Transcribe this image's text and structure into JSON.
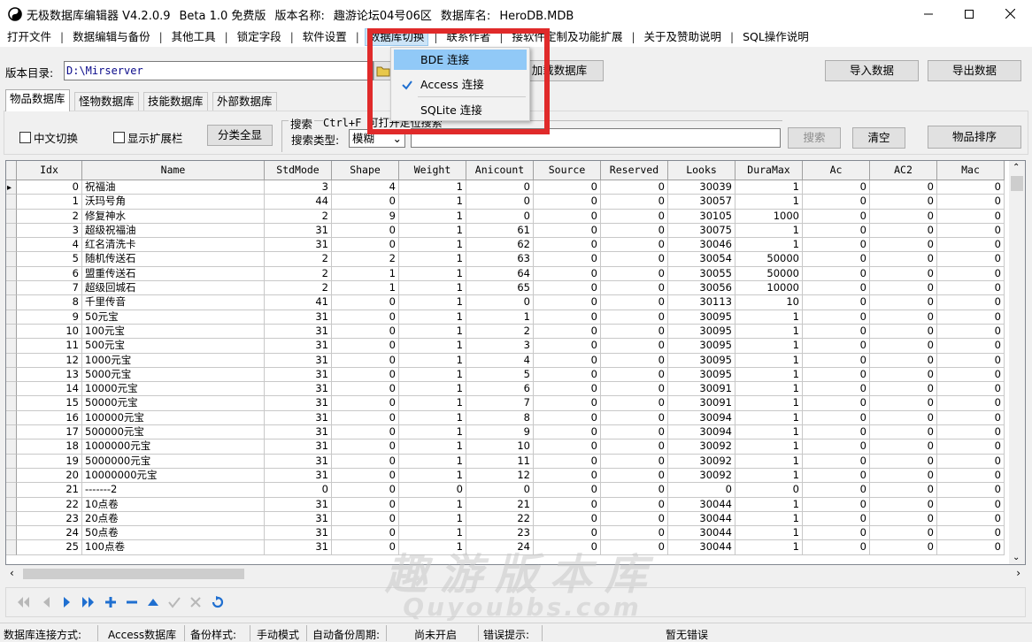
{
  "window": {
    "title_parts": [
      "无极数据库编辑器 V4.2.0.9",
      "Beta 1.0 免费版",
      "版本名称:",
      "趣游论坛04号06区",
      "数据库名:",
      "HeroDB.MDB"
    ],
    "controls": {
      "minimize": "—",
      "maximize": "☐",
      "close": "✕"
    }
  },
  "menu": {
    "items": [
      "打开文件",
      "数据编辑与备份",
      "其他工具",
      "锁定字段",
      "软件设置",
      "数据库切换",
      "联系作者",
      "接软件定制及功能扩展",
      "关于及赞助说明",
      "SQL操作说明"
    ],
    "separator": "|"
  },
  "dropdown": {
    "items": [
      {
        "label": "BDE 连接",
        "checked": false,
        "highlighted": true
      },
      {
        "label": "Access 连接",
        "checked": true,
        "highlighted": false
      },
      {
        "label": "SQLite 连接",
        "checked": false,
        "highlighted": false
      }
    ]
  },
  "toolbar": {
    "dir_label": "版本目录:",
    "dir_value": "D:\\Mirserver",
    "load_db_label": "加载数据库",
    "import_label": "导入数据",
    "export_label": "导出数据"
  },
  "tabs": [
    "物品数据库",
    "怪物数据库",
    "技能数据库",
    "外部数据库"
  ],
  "filters": {
    "chinese_toggle": "中文切换",
    "show_extended": "显示扩展栏",
    "show_all_categories": "分类全显",
    "search_group_title": "搜索",
    "search_hint": "Ctrl+F 可打开定位搜索",
    "search_type_label": "搜索类型:",
    "search_type_value": "模糊",
    "search_button": "搜索",
    "clear_button": "清空",
    "sort_button": "物品排序"
  },
  "grid": {
    "columns": [
      "Idx",
      "Name",
      "StdMode",
      "Shape",
      "Weight",
      "Anicount",
      "Source",
      "Reserved",
      "Looks",
      "DuraMax",
      "Ac",
      "AC2",
      "Mac"
    ],
    "rows": [
      [
        "0",
        "祝福油",
        "3",
        "4",
        "1",
        "0",
        "0",
        "0",
        "30039",
        "1",
        "0",
        "0",
        "0"
      ],
      [
        "1",
        "沃玛号角",
        "44",
        "0",
        "1",
        "0",
        "0",
        "0",
        "30057",
        "1",
        "0",
        "0",
        "0"
      ],
      [
        "2",
        "修复神水",
        "2",
        "9",
        "1",
        "0",
        "0",
        "0",
        "30105",
        "1000",
        "0",
        "0",
        "0"
      ],
      [
        "3",
        "超级祝福油",
        "31",
        "0",
        "1",
        "61",
        "0",
        "0",
        "30075",
        "1",
        "0",
        "0",
        "0"
      ],
      [
        "4",
        "红名清洗卡",
        "31",
        "0",
        "1",
        "62",
        "0",
        "0",
        "30046",
        "1",
        "0",
        "0",
        "0"
      ],
      [
        "5",
        "随机传送石",
        "2",
        "2",
        "1",
        "63",
        "0",
        "0",
        "30054",
        "50000",
        "0",
        "0",
        "0"
      ],
      [
        "6",
        "盟重传送石",
        "2",
        "1",
        "1",
        "64",
        "0",
        "0",
        "30055",
        "50000",
        "0",
        "0",
        "0"
      ],
      [
        "7",
        "超级回城石",
        "2",
        "1",
        "1",
        "65",
        "0",
        "0",
        "30056",
        "10000",
        "0",
        "0",
        "0"
      ],
      [
        "8",
        "千里传音",
        "41",
        "0",
        "1",
        "0",
        "0",
        "0",
        "30113",
        "10",
        "0",
        "0",
        "0"
      ],
      [
        "9",
        "50元宝",
        "31",
        "0",
        "1",
        "1",
        "0",
        "0",
        "30095",
        "1",
        "0",
        "0",
        "0"
      ],
      [
        "10",
        "100元宝",
        "31",
        "0",
        "1",
        "2",
        "0",
        "0",
        "30095",
        "1",
        "0",
        "0",
        "0"
      ],
      [
        "11",
        "500元宝",
        "31",
        "0",
        "1",
        "3",
        "0",
        "0",
        "30095",
        "1",
        "0",
        "0",
        "0"
      ],
      [
        "12",
        "1000元宝",
        "31",
        "0",
        "1",
        "4",
        "0",
        "0",
        "30095",
        "1",
        "0",
        "0",
        "0"
      ],
      [
        "13",
        "5000元宝",
        "31",
        "0",
        "1",
        "5",
        "0",
        "0",
        "30095",
        "1",
        "0",
        "0",
        "0"
      ],
      [
        "14",
        "10000元宝",
        "31",
        "0",
        "1",
        "6",
        "0",
        "0",
        "30091",
        "1",
        "0",
        "0",
        "0"
      ],
      [
        "15",
        "50000元宝",
        "31",
        "0",
        "1",
        "7",
        "0",
        "0",
        "30091",
        "1",
        "0",
        "0",
        "0"
      ],
      [
        "16",
        "100000元宝",
        "31",
        "0",
        "1",
        "8",
        "0",
        "0",
        "30094",
        "1",
        "0",
        "0",
        "0"
      ],
      [
        "17",
        "500000元宝",
        "31",
        "0",
        "1",
        "9",
        "0",
        "0",
        "30094",
        "1",
        "0",
        "0",
        "0"
      ],
      [
        "18",
        "1000000元宝",
        "31",
        "0",
        "1",
        "10",
        "0",
        "0",
        "30092",
        "1",
        "0",
        "0",
        "0"
      ],
      [
        "19",
        "5000000元宝",
        "31",
        "0",
        "1",
        "11",
        "0",
        "0",
        "30092",
        "1",
        "0",
        "0",
        "0"
      ],
      [
        "20",
        "10000000元宝",
        "31",
        "0",
        "1",
        "12",
        "0",
        "0",
        "30092",
        "1",
        "0",
        "0",
        "0"
      ],
      [
        "21",
        "-------2",
        "0",
        "0",
        "0",
        "0",
        "0",
        "0",
        "0",
        "0",
        "0",
        "0",
        "0"
      ],
      [
        "22",
        "10点卷",
        "31",
        "0",
        "1",
        "21",
        "0",
        "0",
        "30044",
        "1",
        "0",
        "0",
        "0"
      ],
      [
        "23",
        "20点卷",
        "31",
        "0",
        "1",
        "22",
        "0",
        "0",
        "30044",
        "1",
        "0",
        "0",
        "0"
      ],
      [
        "24",
        "50点卷",
        "31",
        "0",
        "1",
        "23",
        "0",
        "0",
        "30044",
        "1",
        "0",
        "0",
        "0"
      ],
      [
        "25",
        "100点卷",
        "31",
        "0",
        "1",
        "24",
        "0",
        "0",
        "30044",
        "1",
        "0",
        "0",
        "0"
      ]
    ]
  },
  "navigator": [
    "first-icon",
    "prior-icon",
    "next-icon",
    "last-icon",
    "insert-icon",
    "delete-icon",
    "edit-icon",
    "post-icon",
    "cancel-icon",
    "refresh-icon"
  ],
  "status": {
    "conn_label": "数据库连接方式:",
    "conn_value": "Access数据库",
    "backup_label": "备份样式:",
    "backup_value": "手动模式",
    "auto_backup_label": "自动备份周期:",
    "auto_backup_value": "尚未开启",
    "error_label": "错误提示:",
    "error_value": "暂无错误"
  },
  "watermark": {
    "cn": "趣游版本库",
    "en": "Quyoubbs.com"
  },
  "colors": {
    "highlight": "#91c9f7",
    "red_box": "#e02a2a",
    "menu_active": "#cce4f7",
    "nav_blue": "#1f6fd0"
  }
}
